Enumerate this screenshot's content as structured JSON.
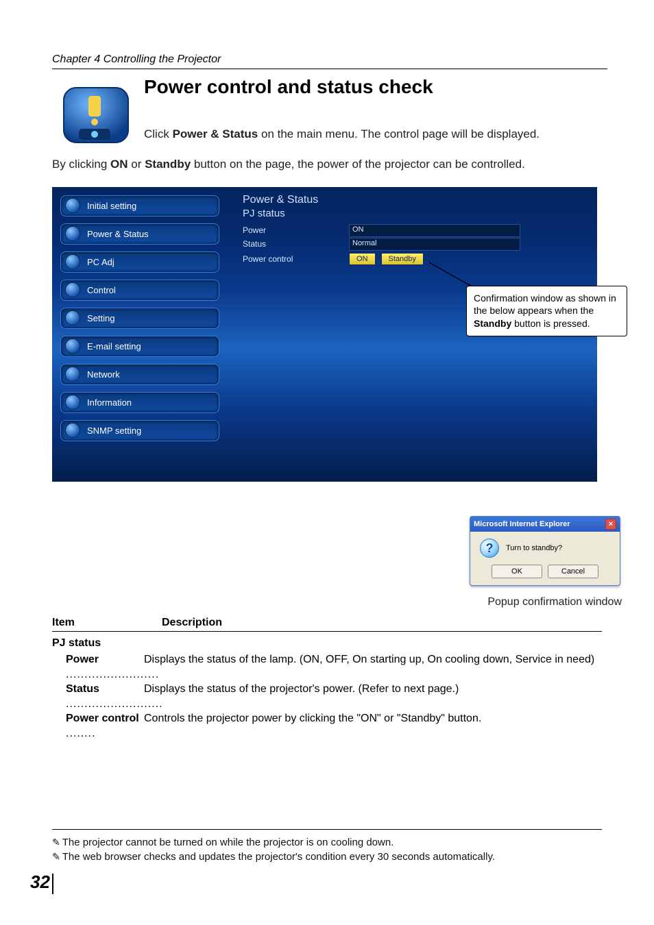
{
  "chapter": "Chapter 4 Controlling the Projector",
  "title": "Power control and status check",
  "intro1_pre": "Click ",
  "intro1_b": "Power & Status",
  "intro1_post": " on the main menu. The control page will be displayed.",
  "intro2_pre": "By clicking ",
  "intro2_b1": "ON",
  "intro2_mid": " or ",
  "intro2_b2": "Standby",
  "intro2_post": " button on the page, the power of the projector can be controlled.",
  "ui": {
    "panel_title": "Power & Status",
    "panel_sub": "PJ status",
    "menu": [
      "Initial setting",
      "Power & Status",
      "PC Adj",
      "Control",
      "Setting",
      "E-mail setting",
      "Network",
      "Information",
      "SNMP setting"
    ],
    "labels": {
      "power": "Power",
      "status": "Status",
      "pcontrol": "Power control"
    },
    "values": {
      "power": "ON",
      "status": "Normal"
    },
    "buttons": {
      "on": "ON",
      "standby": "Standby"
    }
  },
  "callout_pre": "Confirmation window  as shown in the below appears  when the ",
  "callout_b": "Standby",
  "callout_post": " button is pressed.",
  "popup": {
    "title": "Microsoft Internet Explorer",
    "message": "Turn to standby?",
    "ok": "OK",
    "cancel": "Cancel"
  },
  "popup_caption": "Popup confirmation window",
  "table": {
    "h1": "Item",
    "h2": "Description",
    "sub": "PJ status",
    "r1t": "Power",
    "r1d": "Displays the status of the lamp. (ON, OFF, On starting up, On cooling down, Service in need)",
    "r2t": "Status",
    "r2d": "Displays the status of the projector's power. (Refer to next page.)",
    "r3t": "Power control",
    "r3d": "Controls the projector power by clicking the \"ON\" or \"Standby\" button."
  },
  "footnote1": "The projector cannot be turned on while the projector is on cooling down.",
  "footnote2": "The web browser checks and updates the projector's condition every 30 seconds automatically.",
  "pagenum": "32"
}
